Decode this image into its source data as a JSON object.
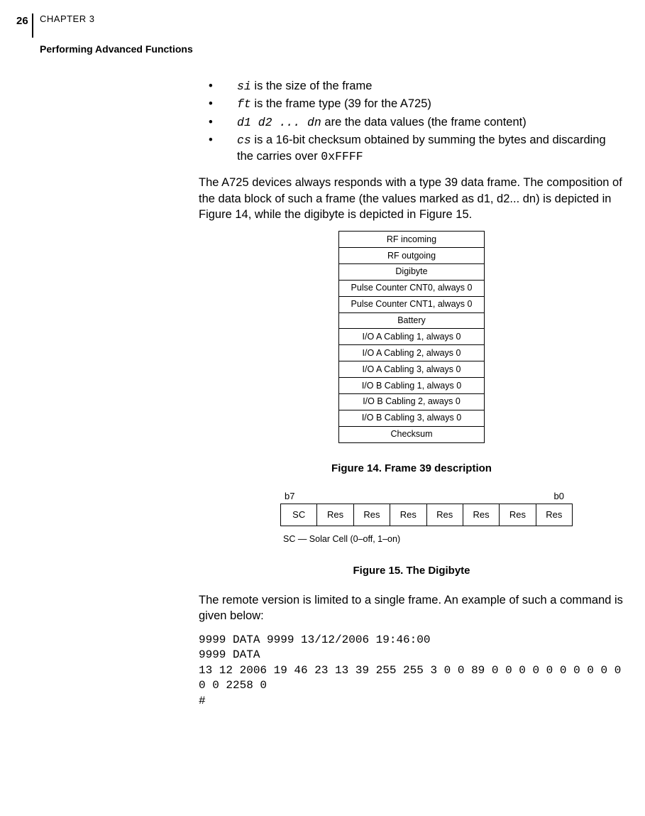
{
  "header": {
    "page_num": "26",
    "chapter": "CHAPTER 3",
    "title": "Performing Advanced Functions"
  },
  "bullets": {
    "b1_code": "si",
    "b1_text": " is the size of the frame",
    "b2_code": "ft",
    "b2_text": " is the frame type (39 for the A725)",
    "b3_code": "d1 d2 ... dn",
    "b3_text": " are the data values (the frame content)",
    "b4_code": "cs",
    "b4_text_a": " is a 16-bit checksum obtained by summing the bytes and discarding the carries over ",
    "b4_text_b": "0xFFFF"
  },
  "para1": "The A725 devices always responds with a type 39 data frame. The composition of the data block of such a frame (the values marked as d1, d2... dn) is depicted in Figure 14, while the digibyte is depicted in Figure 15.",
  "fig14": {
    "rows": [
      "RF incoming",
      "RF outgoing",
      "Digibyte",
      "Pulse Counter CNT0, always 0",
      "Pulse Counter CNT1, always 0",
      "Battery",
      "I/O A Cabling 1, always 0",
      "I/O A Cabling 2, always 0",
      "I/O A Cabling 3, always 0",
      "I/O B Cabling 1, always 0",
      "I/O B Cabling 2, aways 0",
      "I/O B Cabling 3, always 0",
      "Checksum"
    ],
    "caption": "Figure 14.  Frame 39 description"
  },
  "fig15": {
    "b7": "b7",
    "b0": "b0",
    "cells": [
      "SC",
      "Res",
      "Res",
      "Res",
      "Res",
      "Res",
      "Res",
      "Res"
    ],
    "sc_note": "SC — Solar Cell (0–off, 1–on)",
    "caption": "Figure 15.  The Digibyte"
  },
  "para2": "The remote version is limited to a single frame. An example of such a command is given below:",
  "code_block": "9999 DATA 9999 13/12/2006 19:46:00\n9999 DATA\n13 12 2006 19 46 23 13 39 255 255 3 0 0 89 0 0 0 0 0 0 0 0 0 0 0 0 2258 0\n#"
}
